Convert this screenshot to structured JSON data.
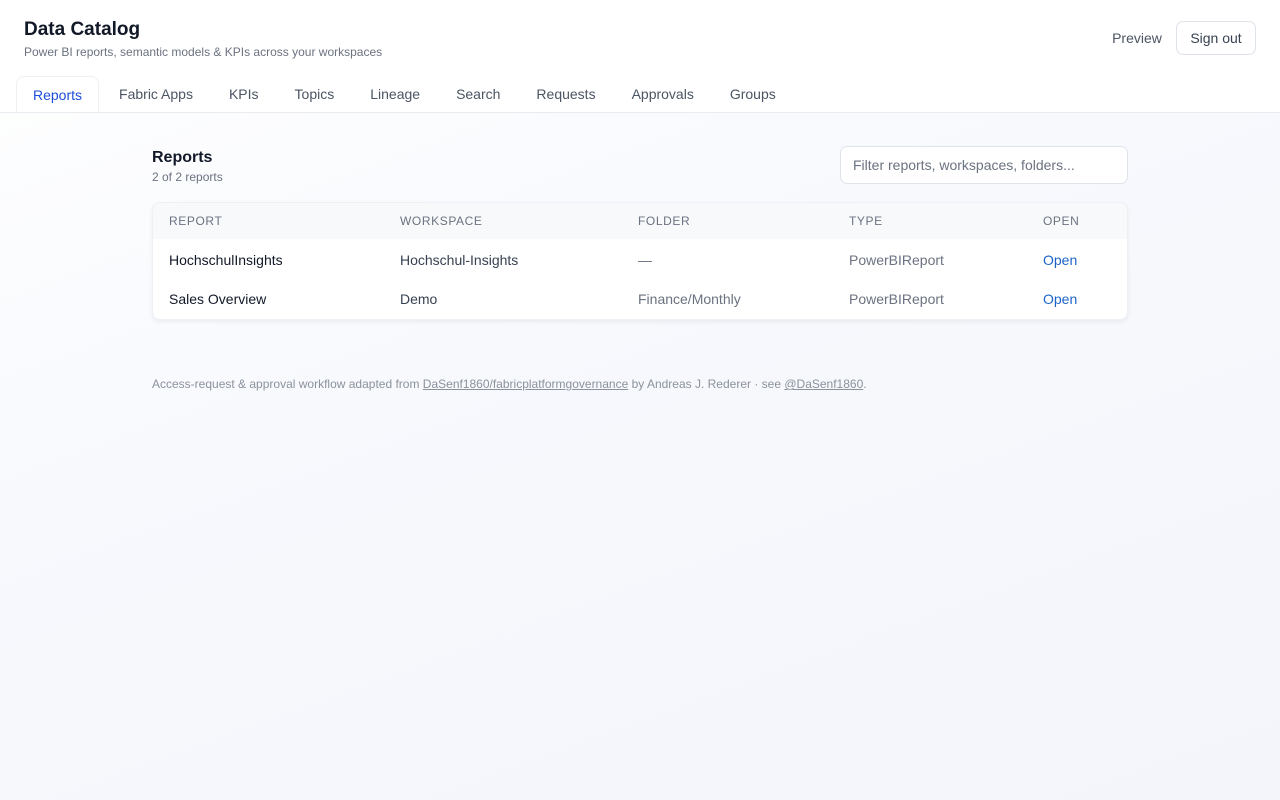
{
  "header": {
    "title": "Data Catalog",
    "subtitle": "Power BI reports, semantic models & KPIs across your workspaces",
    "preview_label": "Preview",
    "signout_label": "Sign out"
  },
  "tabs": [
    {
      "label": "Reports",
      "active": true
    },
    {
      "label": "Fabric Apps",
      "active": false
    },
    {
      "label": "KPIs",
      "active": false
    },
    {
      "label": "Topics",
      "active": false
    },
    {
      "label": "Lineage",
      "active": false
    },
    {
      "label": "Search",
      "active": false
    },
    {
      "label": "Requests",
      "active": false
    },
    {
      "label": "Approvals",
      "active": false
    },
    {
      "label": "Groups",
      "active": false
    }
  ],
  "main": {
    "title": "Reports",
    "count_text": "2 of 2 reports",
    "filter_placeholder": "Filter reports, workspaces, folders...",
    "filter_value": ""
  },
  "table": {
    "columns": [
      "REPORT",
      "WORKSPACE",
      "FOLDER",
      "TYPE",
      "OPEN"
    ],
    "rows": [
      {
        "report": "HochschulInsights",
        "workspace": "Hochschul-Insights",
        "folder": "—",
        "type": "PowerBIReport",
        "open": "Open"
      },
      {
        "report": "Sales Overview",
        "workspace": "Demo",
        "folder": "Finance/Monthly",
        "type": "PowerBIReport",
        "open": "Open"
      }
    ]
  },
  "footer": {
    "prefix": "Access-request & approval workflow adapted from ",
    "repo_link": "DaSenf1860/fabricplatformgovernance",
    "middle": " by Andreas J. Rederer · see ",
    "profile_link": "@DaSenf1860",
    "suffix": "."
  },
  "colors": {
    "accent": "#1d4ed8",
    "link": "#1d64c8",
    "muted_text": "#6b7280"
  }
}
